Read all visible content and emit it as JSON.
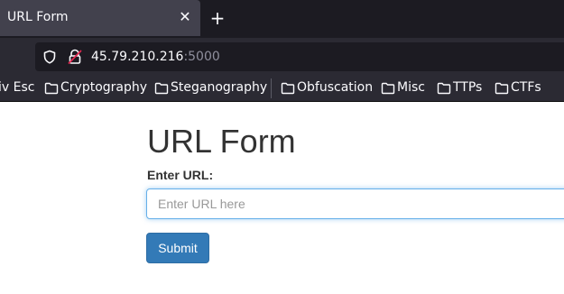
{
  "browser": {
    "tab": {
      "title": "URL Form",
      "close_glyph": "✕"
    },
    "new_tab_glyph": "+",
    "address": {
      "host": "45.79.210.216",
      "port": ":5000"
    },
    "bookmarks": [
      {
        "label": "iv Esc",
        "folder": false
      },
      {
        "label": "Cryptography",
        "folder": true
      },
      {
        "label": "Steganography",
        "folder": true
      },
      {
        "label": "Obfuscation",
        "folder": true
      },
      {
        "label": "Misc",
        "folder": true
      },
      {
        "label": "TTPs",
        "folder": true
      },
      {
        "label": "CTFs",
        "folder": true
      }
    ]
  },
  "page": {
    "title": "URL Form",
    "field_label": "Enter URL:",
    "input": {
      "value": "",
      "placeholder": "Enter URL here"
    },
    "submit_label": "Submit"
  },
  "colors": {
    "primary_button": "#337ab7",
    "focus_border": "#66afe9",
    "browser_dark": "#1c1b22",
    "toolbar": "#2b2a33"
  }
}
